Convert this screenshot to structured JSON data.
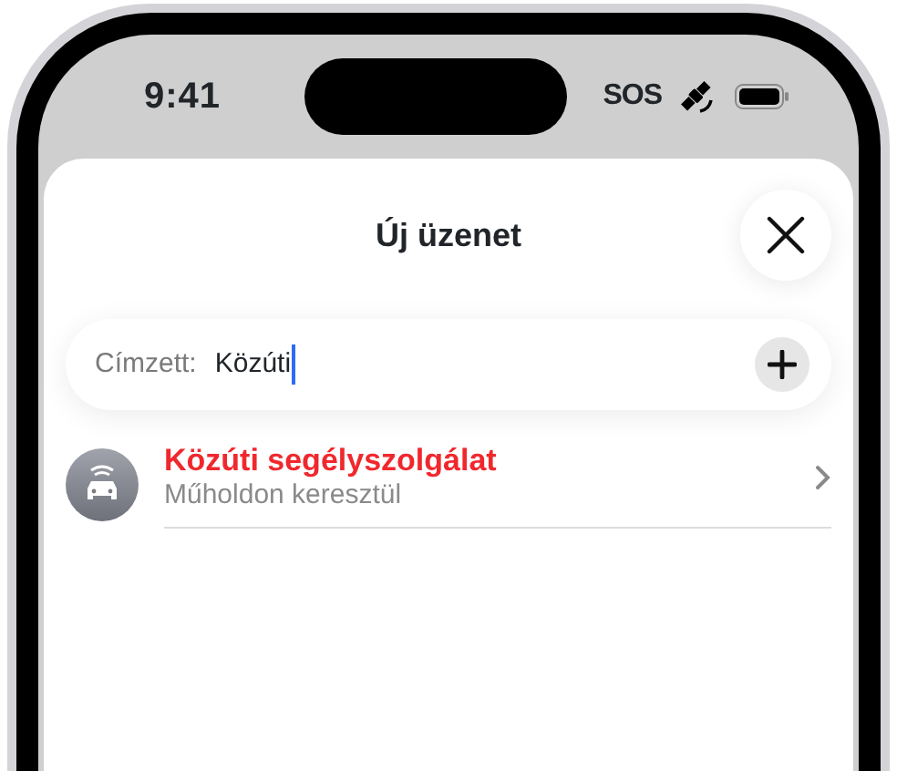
{
  "status_bar": {
    "time": "9:41",
    "sos": "SOS"
  },
  "sheet": {
    "title": "Új üzenet"
  },
  "recipient_field": {
    "label": "Címzett:",
    "value": "Közúti"
  },
  "results": [
    {
      "title": "Közúti segélyszolgálat",
      "subtitle": "Műholdon keresztül"
    }
  ]
}
